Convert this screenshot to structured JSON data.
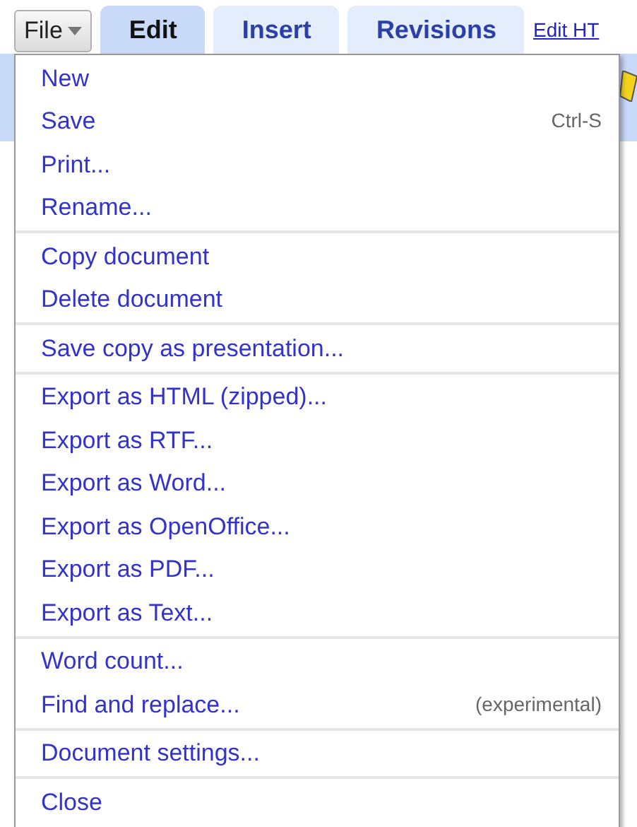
{
  "file_button": {
    "label": "File"
  },
  "tabs": [
    {
      "label": "Edit",
      "selected": true
    },
    {
      "label": "Insert",
      "selected": false
    },
    {
      "label": "Revisions",
      "selected": false
    }
  ],
  "link": "Edit HT",
  "menu": {
    "groups": [
      {
        "items": [
          {
            "label": "New"
          },
          {
            "label": "Save",
            "shortcut": "Ctrl-S"
          },
          {
            "label": "Print..."
          },
          {
            "label": "Rename..."
          }
        ]
      },
      {
        "items": [
          {
            "label": "Copy document"
          },
          {
            "label": "Delete document"
          }
        ]
      },
      {
        "items": [
          {
            "label": "Save copy as presentation..."
          }
        ]
      },
      {
        "items": [
          {
            "label": "Export as HTML (zipped)..."
          },
          {
            "label": "Export as RTF..."
          },
          {
            "label": "Export as Word..."
          },
          {
            "label": "Export as OpenOffice..."
          },
          {
            "label": "Export as PDF..."
          },
          {
            "label": "Export as Text..."
          }
        ]
      },
      {
        "items": [
          {
            "label": "Word count..."
          },
          {
            "label": "Find and replace...",
            "note": "(experimental)"
          }
        ]
      },
      {
        "items": [
          {
            "label": "Document settings..."
          }
        ]
      },
      {
        "items": [
          {
            "label": "Close"
          }
        ]
      }
    ]
  }
}
